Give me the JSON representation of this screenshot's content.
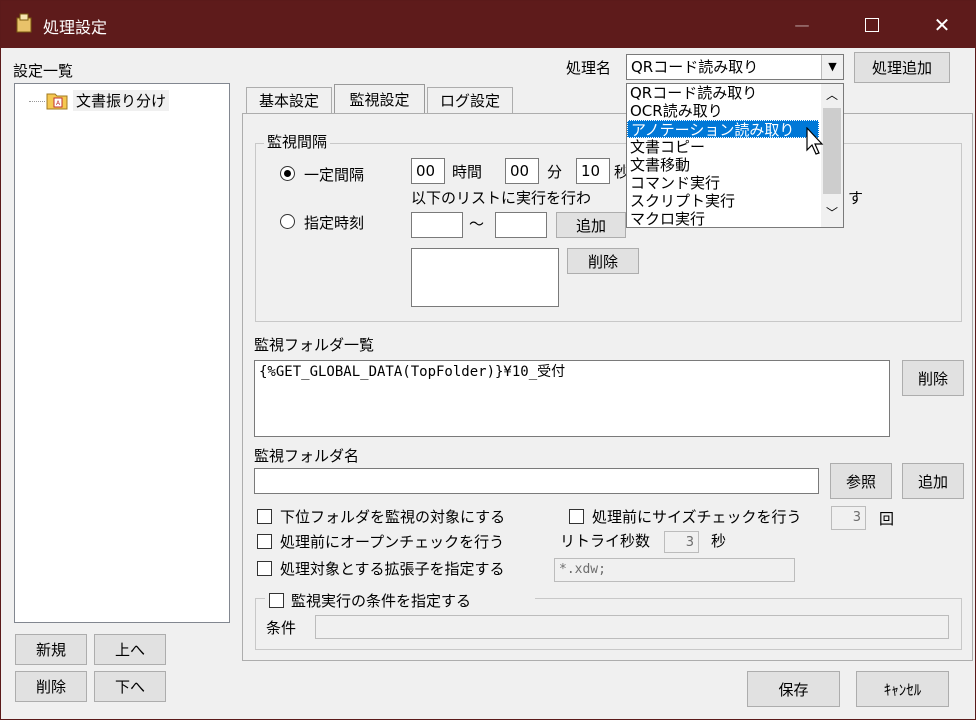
{
  "window": {
    "title": "処理設定",
    "minimize": "—",
    "maximize": "☐",
    "close": "✕"
  },
  "left": {
    "header": "設定一覧",
    "tree": [
      {
        "label": "文書振り分け"
      }
    ],
    "buttons": {
      "new": "新規",
      "up": "上へ",
      "delete": "削除",
      "down": "下へ"
    }
  },
  "top": {
    "process_label": "処理名",
    "process_value": "QRコード読み取り",
    "add_process": "処理追加"
  },
  "dropdown": {
    "items": [
      "QRコード読み取り",
      "OCR読み取り",
      "アノテーション読み取り",
      "文書コピー",
      "文書移動",
      "コマンド実行",
      "スクリプト実行",
      "マクロ実行"
    ],
    "selected_index": 2
  },
  "tabs": [
    "基本設定",
    "監視設定",
    "ログ設定"
  ],
  "active_tab": 1,
  "monitor_interval": {
    "title": "監視間隔",
    "fixed_label": "一定間隔",
    "hours_value": "00",
    "hours_unit": "時間",
    "minutes_value": "00",
    "minutes_unit": "分",
    "seconds_value": "10",
    "seconds_unit": "秒",
    "note": "以下のリストに実行を行わ",
    "note_end": "す",
    "specified_label": "指定時刻",
    "tilde": "〜",
    "add": "追加",
    "delete": "削除"
  },
  "folders": {
    "title": "監視フォルダ一覧",
    "list": [
      "{%GET_GLOBAL_DATA(TopFolder)}¥10_受付"
    ],
    "delete": "削除"
  },
  "folder_name": {
    "title": "監視フォルダ名",
    "value": "",
    "browse": "参照",
    "add": "追加"
  },
  "options": {
    "subfolder": "下位フォルダを監視の対象にする",
    "size_check": "処理前にサイズチェックを行う",
    "size_check_count": "3",
    "size_check_unit": "回",
    "open_check": "処理前にオープンチェックを行う",
    "retry_label": "リトライ秒数",
    "retry_value": "3",
    "retry_unit": "秒",
    "ext_check": "処理対象とする拡張子を指定する",
    "ext_value": "*.xdw;"
  },
  "condition": {
    "title": "監視実行の条件を指定する",
    "label": "条件",
    "value": ""
  },
  "footer": {
    "save": "保存",
    "cancel": "ｷｬﾝｾﾙ"
  }
}
